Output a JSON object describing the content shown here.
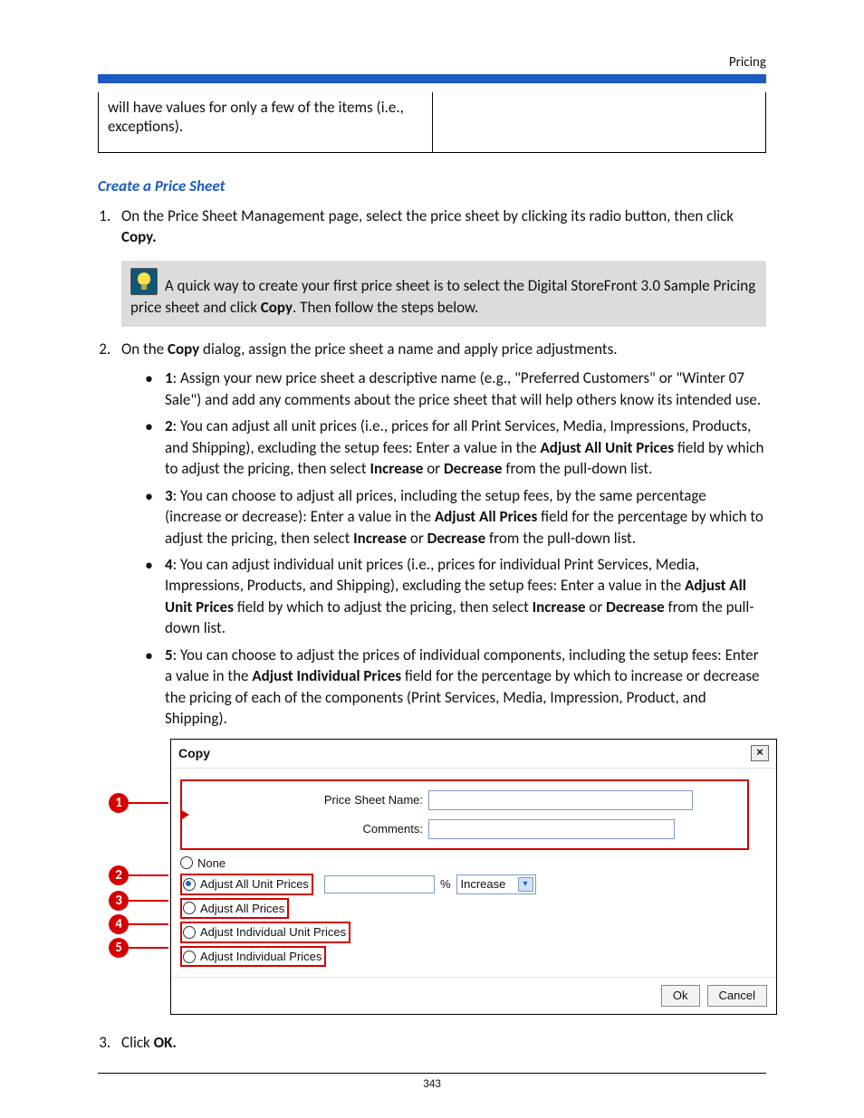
{
  "header": {
    "title": "Pricing"
  },
  "top_table": {
    "left": "will have values for only a few of the items (i.e., exceptions).",
    "right": ""
  },
  "section_title": "Create a Price Sheet",
  "step1": {
    "lead": "On the Price Sheet Management page, select the price sheet by clicking its radio button, then click ",
    "bold": "Copy."
  },
  "tip": {
    "t1": "A quick way to create your first price sheet is to select the Digital StoreFront 3.0 Sample Pricing price sheet and click ",
    "b1": "Copy",
    "t2": ". Then follow the steps below."
  },
  "step2": {
    "lead_a": "On the ",
    "lead_b": "Copy",
    "lead_c": " dialog, assign the price sheet a name and apply price adjustments.",
    "bullets": [
      {
        "num": "1",
        "t": ": Assign your new price sheet a descriptive name (e.g., \"Preferred Customers\" or \"Winter 07 Sale\") and add any comments about the price sheet that will help others know its intended use."
      },
      {
        "num": "2",
        "a": ": You can adjust all unit prices (i.e., prices for all Print Services, Media, Impressions, Products, and Shipping), excluding the setup fees: Enter a value in the ",
        "b1": "Adjust All Unit Prices",
        "c": " field by which to adjust the pricing, then select ",
        "b2": "Increase",
        "d": " or ",
        "b3": "Decrease",
        "e": " from the pull-down list."
      },
      {
        "num": "3",
        "a": ": You can choose to adjust all prices, including the setup fees, by the same percentage (increase or decrease): Enter a value in the ",
        "b1": "Adjust All Prices",
        "c": " field for the percentage by which to adjust the pricing, then select ",
        "b2": "Increase",
        "d": " or ",
        "b3": "Decrease",
        "e": " from the pull-down list."
      },
      {
        "num": "4",
        "a": ": You can adjust individual unit prices (i.e., prices for individual Print Services, Media, Impressions, Products, and Shipping), excluding the setup fees: Enter a value in the ",
        "b1": "Adjust All Unit Prices",
        "c": " field by which to adjust the pricing, then select ",
        "b2": "Increase",
        "d": " or ",
        "b3": "Decrease",
        "e": " from the pull-down list."
      },
      {
        "num": "5",
        "a": ": You can choose to adjust the prices of individual components, including the setup fees: Enter a value in the ",
        "b1": "Adjust Individual Prices",
        "c": " field for the percentage by which to increase or decrease the pricing of each of the components (Print Services, Media, Impression, Product, and Shipping)."
      }
    ]
  },
  "dialog": {
    "title": "Copy",
    "close": "×",
    "price_sheet_label": "Price Sheet Name:",
    "comments_label": "Comments:",
    "none": "None",
    "opt2": "Adjust All Unit Prices",
    "opt3": "Adjust All Prices",
    "opt4": "Adjust Individual Unit Prices",
    "opt5": "Adjust Individual Prices",
    "percent": "%",
    "select_val": "Increase",
    "ok": "Ok",
    "cancel": "Cancel"
  },
  "callouts": {
    "c1": "1",
    "c2": "2",
    "c3": "3",
    "c4": "4",
    "c5": "5"
  },
  "step3": {
    "a": "Click ",
    "b": "OK."
  },
  "page_number": "343"
}
